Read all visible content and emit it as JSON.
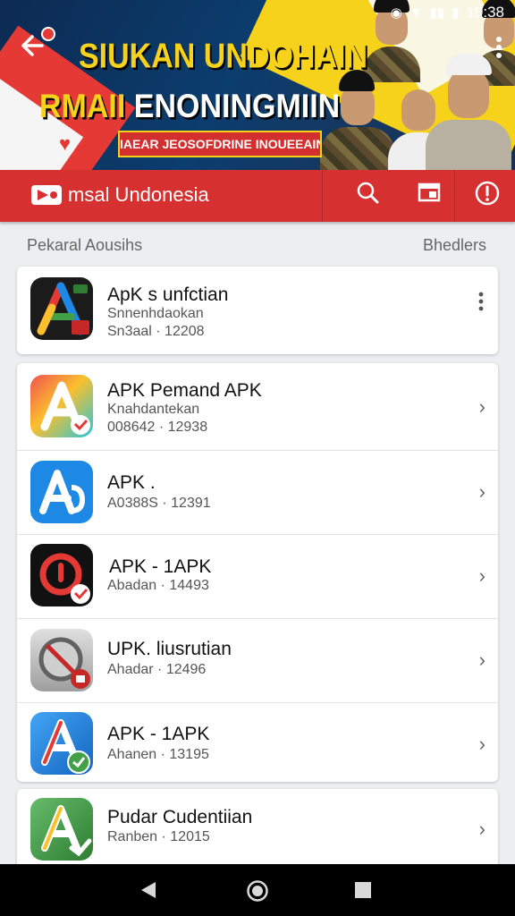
{
  "status": {
    "time": "10:38"
  },
  "banner": {
    "headline_line1": "SIUKAN UNDOHAIN",
    "headline_line2_white": "RMAII ",
    "headline_line2_rest": "ENONINGMIIN",
    "ribbon_text": "IAEAR JEOSOFDRINE INOUEEAIN"
  },
  "appbar": {
    "title": "msal Undonesia",
    "actions": [
      "search-icon",
      "window-icon",
      "alert-icon"
    ]
  },
  "section": {
    "left_label": "Pekaral Aousihs",
    "right_label": "Bhedlers"
  },
  "featured": {
    "name": "ApK s unfctian",
    "line1": "Snnenhdaokan",
    "line2": "Sn3aal · 12208"
  },
  "apps": [
    {
      "name": "APK Pemand APK",
      "line1": "Knahdantekan",
      "line2": "008642 · 12938"
    },
    {
      "name": "APK .",
      "line1": "A0388S · 12391"
    },
    {
      "name": "APK - 1APK",
      "line1": "Abadan · 14493"
    },
    {
      "name": "UPK. liusrutian",
      "line1": "Ahadar · 12496"
    },
    {
      "name": "APK - 1APK",
      "line1": "Ahanen · 13195"
    }
  ],
  "last": {
    "name": "Pudar Cudentiian",
    "line1": "Ranben · 12015"
  },
  "colors": {
    "accent_red": "#d63030",
    "banner_yellow": "#f6d21a"
  }
}
